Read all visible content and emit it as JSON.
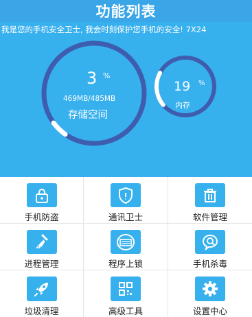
{
  "title": "功能列表",
  "marquee": "我是您的手机安全卫士, 我会时刻保护您手机的安全! 7X24",
  "storage": {
    "percent": "3",
    "percent_sign": "%",
    "detail": "469MB/485MB",
    "label": "存储空间",
    "fill": 0.03
  },
  "memory": {
    "percent": "19",
    "percent_sign": "%",
    "label": "内存",
    "fill": 0.19
  },
  "colors": {
    "title_bar": "#3aa6e8",
    "hero_background": "#37b0ee",
    "ring_track": "#3f5dae",
    "ring_fill": "#ffffff",
    "tile": "#37b0ee"
  },
  "functions": [
    {
      "label": "手机防盗",
      "icon": "lock-icon"
    },
    {
      "label": "通讯卫士",
      "icon": "shield-icon"
    },
    {
      "label": "软件管理",
      "icon": "trash-icon"
    },
    {
      "label": "进程管理",
      "icon": "broom-icon"
    },
    {
      "label": "程序上锁",
      "icon": "app-lock-icon"
    },
    {
      "label": "手机杀毒",
      "icon": "virus-scan-icon"
    },
    {
      "label": "垃圾清理",
      "icon": "rocket-icon"
    },
    {
      "label": "高级工具",
      "icon": "qr-tools-icon"
    },
    {
      "label": "设置中心",
      "icon": "gear-icon"
    }
  ]
}
